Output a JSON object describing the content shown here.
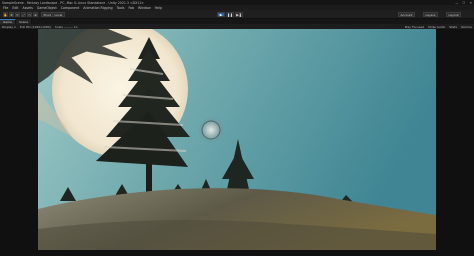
{
  "window": {
    "title": "SampleScene - Fantasy Landscape - PC, Mac & Linux Standalone - Unity 2021.3 <DX11>",
    "controls": [
      "—",
      "☐",
      "✕"
    ]
  },
  "menu": {
    "items": [
      "File",
      "Edit",
      "Assets",
      "GameObject",
      "Component",
      "Animation Rigging",
      "Tools",
      "Fab",
      "Window",
      "Help"
    ]
  },
  "toolbar": {
    "tools": [
      "✋",
      "✥",
      "⟳",
      "⤢",
      "▭",
      "⊕"
    ],
    "pivot_label": "Pivot",
    "local_label": "Local",
    "play_icon": "▶",
    "pause_icon": "❚❚",
    "step_icon": "▶❚",
    "account_label": "Account",
    "layers_label": "Layers",
    "layout_label": "Layout"
  },
  "tabs": [
    {
      "label": "Game",
      "active": true
    },
    {
      "label": "Scene",
      "active": false
    }
  ],
  "gamebar": {
    "display_label": "Display 1",
    "resolution_label": "Full HD (1920x1080)",
    "scale_label": "Scale ——— 1x",
    "play_focused_label": "Play Focused",
    "mute_label": "Mute Audio",
    "stats_label": "Stats",
    "gizmos_label": "Gizmos"
  },
  "viewport": {
    "scene_description_icon": "landscape-scene",
    "sky_color_top": "#4a8f9a",
    "sky_color_bottom": "#8fc0c0",
    "moon_color": "#f3ead6",
    "ground_color": "#6b6650"
  }
}
